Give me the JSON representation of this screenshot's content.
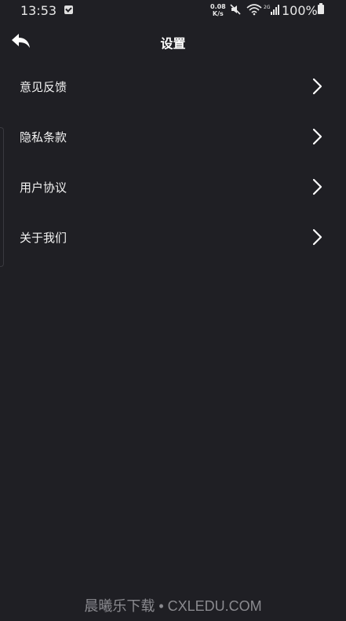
{
  "status_bar": {
    "time": "13:53",
    "net_speed_value": "0.08",
    "net_speed_unit": "K/s",
    "battery": "100%",
    "icons": [
      "mail-icon",
      "mute-icon",
      "wifi-icon",
      "signal-icon",
      "battery-icon"
    ]
  },
  "header": {
    "title": "设置",
    "back_icon": "back-arrow-icon"
  },
  "settings": {
    "items": [
      {
        "label": "意见反馈"
      },
      {
        "label": "隐私条款"
      },
      {
        "label": "用户协议"
      },
      {
        "label": "关于我们"
      }
    ]
  },
  "watermark": {
    "text": "晨曦乐下载 • CXLEDU.COM"
  },
  "colors": {
    "background": "#1f1f24",
    "text": "#ffffff",
    "watermark": "#8a8a8f"
  }
}
